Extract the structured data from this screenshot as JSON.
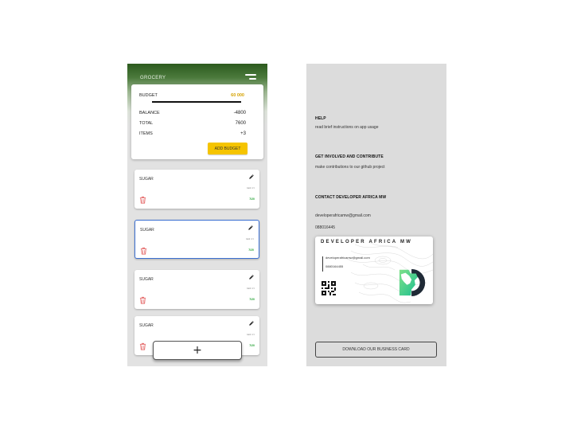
{
  "app": {
    "title": "GROCERY"
  },
  "budget_card": {
    "budget_label": "BUDGET",
    "budget_value": "60 000",
    "balance_label": "BALANCE",
    "balance_value": "-4800",
    "total_label": "TOTAL",
    "total_value": "7600",
    "items_label": "ITEMS",
    "items_value": "+3",
    "add_button": "ADD BUDGET"
  },
  "items": [
    {
      "name": "SUGAR",
      "qty": "1x4",
      "qty_sub": "3/4",
      "price": "7/20",
      "selected": false
    },
    {
      "name": "SUGAR",
      "qty": "1x4",
      "qty_sub": "3/4",
      "price": "7/20",
      "selected": true
    },
    {
      "name": "SUGAR",
      "qty": "1x4",
      "qty_sub": "3/4",
      "price": "7/20",
      "selected": false
    },
    {
      "name": "SUGAR",
      "qty": "1x4",
      "qty_sub": "3/4",
      "price": "7/20",
      "selected": false
    }
  ],
  "fab": {
    "label": "+"
  },
  "info": {
    "help_title": "HELP",
    "help_text": "read brief instructions on  app usage",
    "contribute_title": "GET INVOLVED AND CONTRIBUTE",
    "contribute_text": "make contributions to our github project",
    "contact_title": "CONTACT DEVELOPER AFRICA MW",
    "email": "developerafricamw@gmail.com",
    "phone": "088016445"
  },
  "business_card": {
    "title": "DEVELOPER AFRICA MW",
    "email": "developerafricamw@gmail.com",
    "phone": "0880164455"
  },
  "download_button": "DOWNLOAD OUR BUSINESS CARD",
  "icons": {
    "menu": "hamburger-menu-icon",
    "edit": "pencil-icon",
    "delete": "trash-icon",
    "add": "plus-icon"
  },
  "colors": {
    "header_green": "#2c5a1e",
    "budget_accent": "#d4a200",
    "add_budget_button": "#f5c400",
    "delete_red": "#e05050",
    "price_green": "#27a337",
    "selected_border": "#3b6fd1"
  }
}
